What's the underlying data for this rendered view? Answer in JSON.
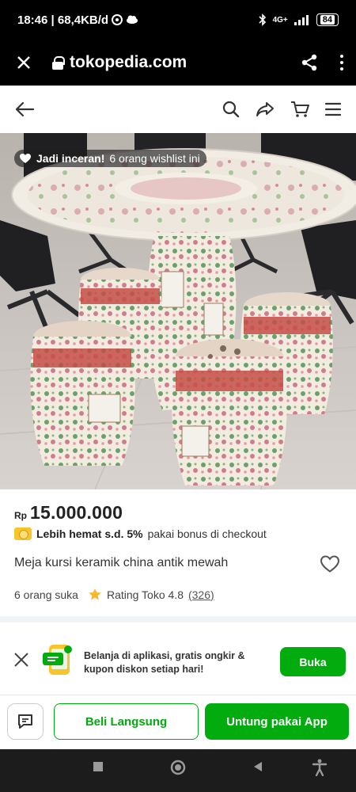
{
  "status_bar": {
    "time_speed": "18:46 | 68,4KB/d",
    "network": "4G+",
    "battery": "84"
  },
  "browser": {
    "domain": "tokopedia.com"
  },
  "product": {
    "wishlist_badge_bold": "Jadi inceran!",
    "wishlist_badge_rest": "6 orang wishlist ini",
    "price_prefix": "Rp",
    "price": "15.000.000",
    "promo_bold": "Lebih hemat s.d. 5%",
    "promo_rest": "pakai bonus di checkout",
    "title": "Meja kursi keramik china antik mewah",
    "likes": "6 orang suka",
    "rating_label": "Rating Toko 4.8",
    "rating_count": "(326)"
  },
  "banner": {
    "text": "Belanja di aplikasi, gratis ongkir & kupon diskon setiap hari!",
    "open_label": "Buka"
  },
  "actions": {
    "buy_now": "Beli Langsung",
    "app_label": "Untung pakai App"
  },
  "colors": {
    "brand_green": "#03ac0e",
    "star_yellow": "#f7b731"
  },
  "icons": [
    "close-icon",
    "lock-icon",
    "share-icon",
    "kebab-menu-icon",
    "back-arrow-icon",
    "search-icon",
    "share-arrow-icon",
    "cart-icon",
    "hamburger-menu-icon",
    "heart-icon",
    "star-icon",
    "chat-icon"
  ]
}
